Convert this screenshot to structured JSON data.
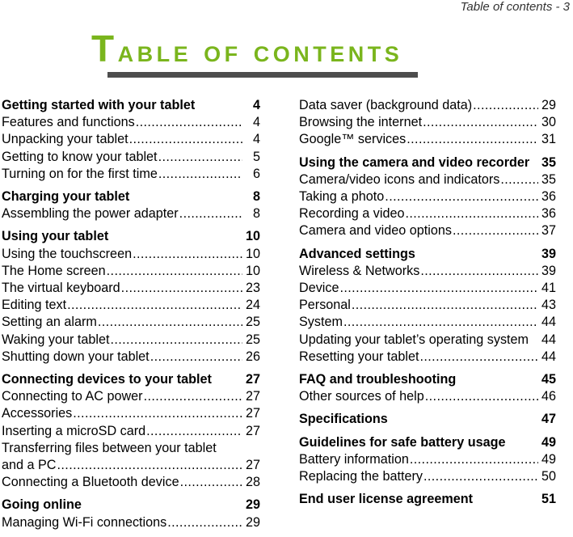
{
  "running_header": "Table of contents - 3",
  "title": {
    "first_letter": "T",
    "rest": "able of contents",
    "color": "#7ab51d"
  },
  "rule_color": "#4d4d4d",
  "columns": [
    {
      "sections": [
        {
          "heading": {
            "label": "Getting started with your tablet",
            "page": "4"
          },
          "items": [
            {
              "label": "Features and functions",
              "page": "4"
            },
            {
              "label": "Unpacking your tablet",
              "page": "4"
            },
            {
              "label": "Getting to know your tablet",
              "page": "5"
            },
            {
              "label": "Turning on for the first time",
              "page": "6"
            }
          ]
        },
        {
          "heading": {
            "label": "Charging your tablet",
            "page": "8"
          },
          "items": [
            {
              "label": "Assembling the power adapter",
              "page": "8"
            }
          ]
        },
        {
          "heading": {
            "label": "Using your tablet",
            "page": "10"
          },
          "items": [
            {
              "label": "Using the touchscreen",
              "page": "10"
            },
            {
              "label": "The Home screen",
              "page": "10"
            },
            {
              "label": "The virtual keyboard",
              "page": "23"
            },
            {
              "label": "Editing text",
              "page": "24"
            },
            {
              "label": "Setting an alarm",
              "page": "25"
            },
            {
              "label": "Waking your tablet",
              "page": "25"
            },
            {
              "label": "Shutting down your tablet",
              "page": "26"
            }
          ]
        },
        {
          "heading": {
            "label": "Connecting devices to your tablet",
            "page": "27"
          },
          "items": [
            {
              "label": "Connecting to AC power",
              "page": "27"
            },
            {
              "label": "Accessories",
              "page": "27"
            },
            {
              "label": "Inserting a microSD card",
              "page": "27"
            },
            {
              "label_line1": "Transferring files between your tablet",
              "label": "and a PC",
              "page": "27"
            },
            {
              "label": "Connecting a Bluetooth device",
              "page": "28"
            }
          ]
        },
        {
          "heading": {
            "label": "Going online",
            "page": "29"
          },
          "items": [
            {
              "label": "Managing Wi-Fi connections",
              "page": "29"
            }
          ]
        }
      ]
    },
    {
      "sections": [
        {
          "heading": null,
          "items": [
            {
              "label": "Data saver (background data)",
              "page": "29"
            },
            {
              "label": "Browsing the internet",
              "page": "30"
            },
            {
              "label": "Google™ services",
              "page": "31"
            }
          ]
        },
        {
          "heading": {
            "label": "Using the camera and video recorder",
            "page": "35"
          },
          "items": [
            {
              "label": "Camera/video icons and indicators",
              "page": "35"
            },
            {
              "label": "Taking a photo",
              "page": "36"
            },
            {
              "label": "Recording a video",
              "page": "36"
            },
            {
              "label": "Camera and video options",
              "page": "37"
            }
          ]
        },
        {
          "heading": {
            "label": "Advanced settings",
            "page": "39"
          },
          "items": [
            {
              "label": "Wireless & Networks",
              "page": "39"
            },
            {
              "label": "Device",
              "page": "41"
            },
            {
              "label": "Personal",
              "page": "43"
            },
            {
              "label": "System",
              "page": "44"
            },
            {
              "label": "Updating your tablet’s operating system",
              "page": "44",
              "no_leader": true
            },
            {
              "label": "Resetting your tablet",
              "page": "44"
            }
          ]
        },
        {
          "heading": {
            "label": "FAQ and troubleshooting",
            "page": "45"
          },
          "items": [
            {
              "label": "Other sources of help",
              "page": "46"
            }
          ]
        },
        {
          "heading": {
            "label": "Specifications",
            "page": "47"
          },
          "items": []
        },
        {
          "heading": {
            "label": "Guidelines for safe battery usage",
            "page": "49"
          },
          "items": [
            {
              "label": "Battery information",
              "page": "49"
            },
            {
              "label": "Replacing the battery",
              "page": "50"
            }
          ]
        },
        {
          "heading": {
            "label": "End user license agreement",
            "page": "51"
          },
          "items": []
        }
      ]
    }
  ]
}
